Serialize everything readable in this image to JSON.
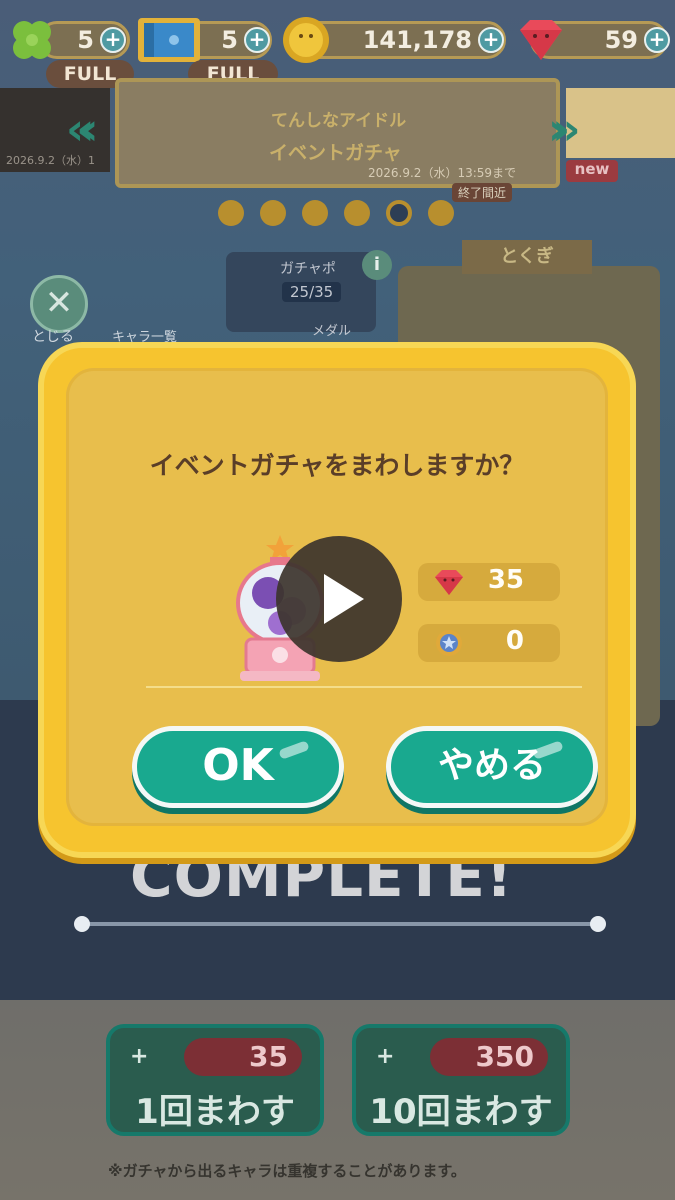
{
  "resources": {
    "clover": {
      "value": "5",
      "status": "FULL",
      "icon": "clover-icon"
    },
    "ticket": {
      "value": "5",
      "status": "FULL",
      "icon": "ticket-icon"
    },
    "coin": {
      "value": "141,178",
      "icon": "coin-icon"
    },
    "gem": {
      "value": "59",
      "icon": "gem-icon"
    },
    "plus": "+"
  },
  "banner": {
    "title_line1": "てんしなアイドル",
    "title_line2": "イベントガチャ",
    "end_date": "2026.9.2（水）13:59まで",
    "ending_soon": "終了間近",
    "left_date": "2026.9.2（水）1",
    "new_badge": "new"
  },
  "side": {
    "close_label": "とじる",
    "chara_label": "キャラ一覧"
  },
  "gachapo": {
    "label": "ガチャポ",
    "count": "25/35",
    "medal_label": "メダル",
    "info": "i"
  },
  "tokugi": "とくぎ",
  "complete_text": "COMPLETE!",
  "modal": {
    "question": "イベントガチャをまわしますか？",
    "gem_cost": "35",
    "medal_cost": "0",
    "ok_label": "OK",
    "cancel_label": "やめる"
  },
  "spin_buttons": [
    {
      "cost": "35",
      "label": "1回まわす",
      "plus": "+"
    },
    {
      "cost": "350",
      "label": "10回まわす",
      "plus": "+"
    }
  ],
  "footnote": "※ガチャから出るキャラは重複することがあります。",
  "colors": {
    "modal_yellow": "#f6c42f",
    "button_teal": "#19a98f",
    "gem_red": "#e94a5a"
  }
}
